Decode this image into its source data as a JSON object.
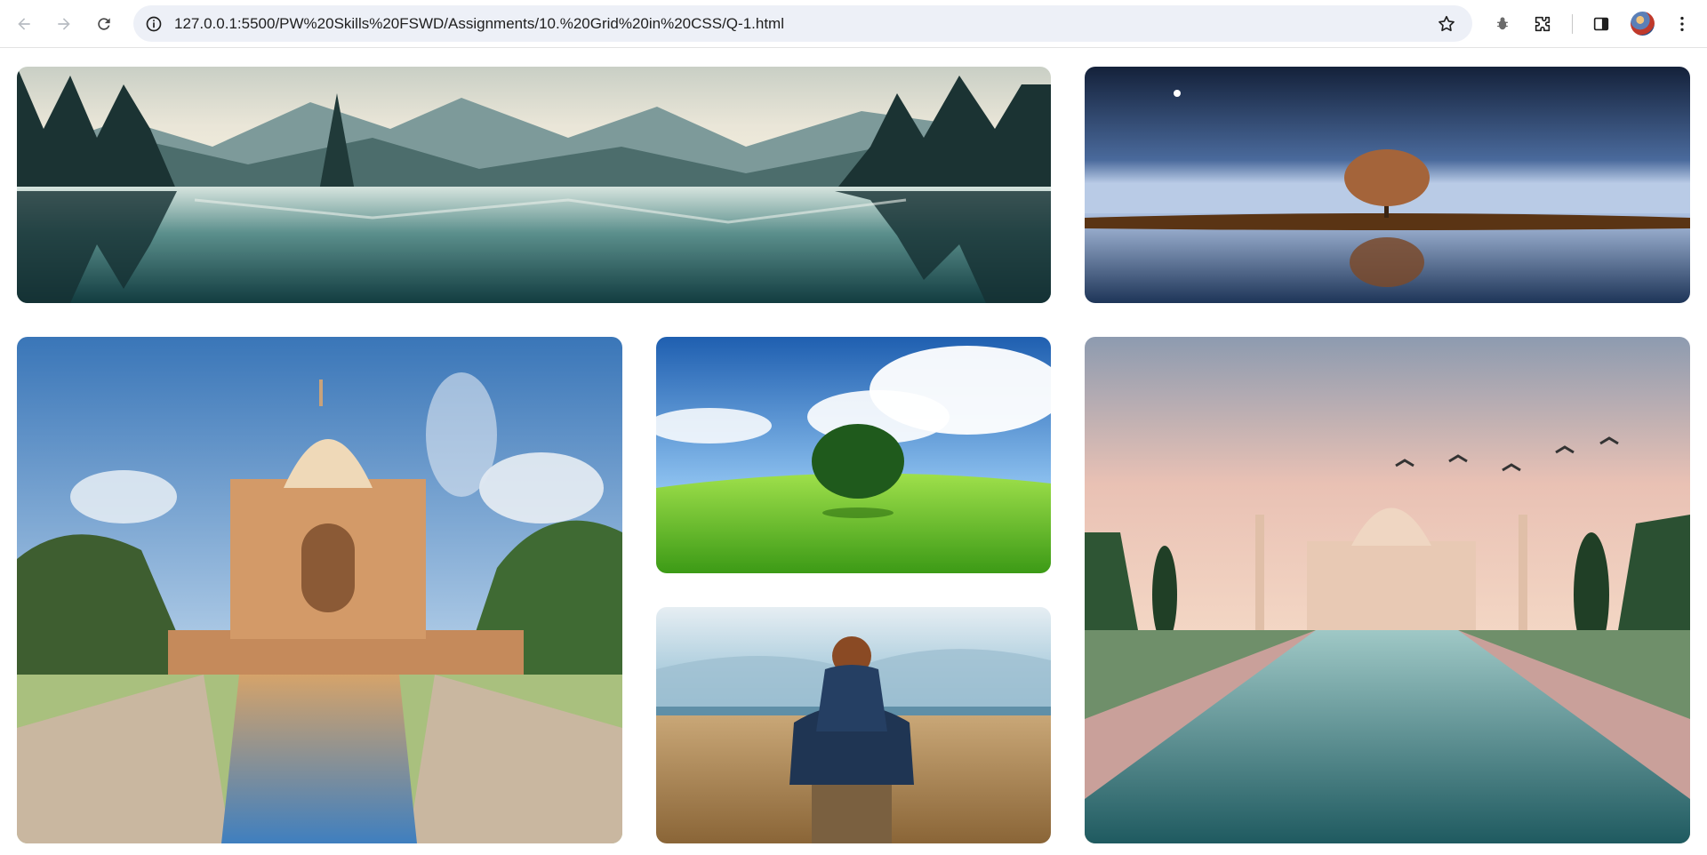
{
  "browser": {
    "url": "127.0.0.1:5500/PW%20Skills%20FSWD/Assignments/10.%20Grid%20in%20CSS/Q-1.html",
    "icons": [
      "back-icon",
      "forward-icon",
      "reload-icon",
      "site-info-icon",
      "star-icon",
      "extension-bug-icon",
      "extensions-puzzle-icon",
      "side-panel-icon",
      "profile-avatar",
      "kebab-menu-icon"
    ]
  },
  "gallery": {
    "images": [
      {
        "id": "mountain-lake",
        "subject": "mountain lake reflection"
      },
      {
        "id": "night-tree",
        "subject": "lone tree at night"
      },
      {
        "id": "tomb",
        "subject": "tomb with reflecting pool"
      },
      {
        "id": "green-tree",
        "subject": "tree on green hill"
      },
      {
        "id": "man-field",
        "subject": "man in field"
      },
      {
        "id": "taj-mahal",
        "subject": "Taj Mahal at sunset"
      }
    ]
  },
  "colors": {
    "chrome_bg": "#ffffff",
    "omnibox_bg": "#edf0f7",
    "icon": "#5f6368"
  }
}
